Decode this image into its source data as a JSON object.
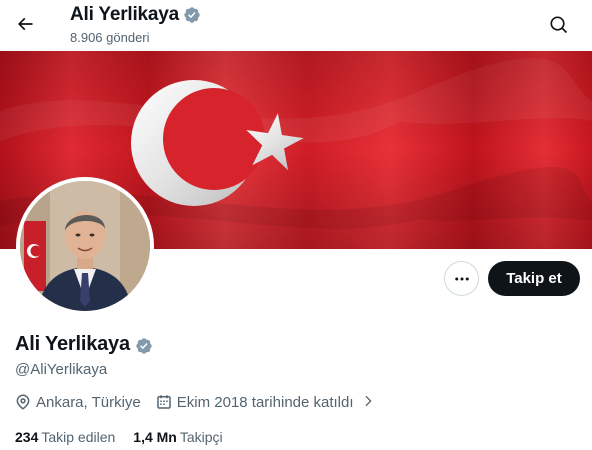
{
  "header": {
    "name": "Ali Yerlikaya",
    "post_count": "8.906 gönderi"
  },
  "icons": {
    "back": "arrow-left-icon",
    "search": "search-icon",
    "verified": "verified-badge-icon",
    "more": "more-dots-icon",
    "location": "location-pin-icon",
    "calendar": "calendar-icon",
    "chevron": "chevron-right-icon"
  },
  "actions": {
    "follow_label": "Takip et"
  },
  "profile": {
    "name": "Ali Yerlikaya",
    "handle": "@AliYerlikaya",
    "location": "Ankara, Türkiye",
    "joined": "Ekim 2018 tarihinde katıldı",
    "following_count": "234",
    "following_label": "Takip edilen",
    "followers_count": "1,4 Mn",
    "followers_label": "Takipçi"
  },
  "colors": {
    "text_primary": "#0f1419",
    "text_secondary": "#536471",
    "verified_badge": "#829aab",
    "flag_red": "#d9202a",
    "button_dark": "#0f1419",
    "border": "#cfd9de"
  }
}
